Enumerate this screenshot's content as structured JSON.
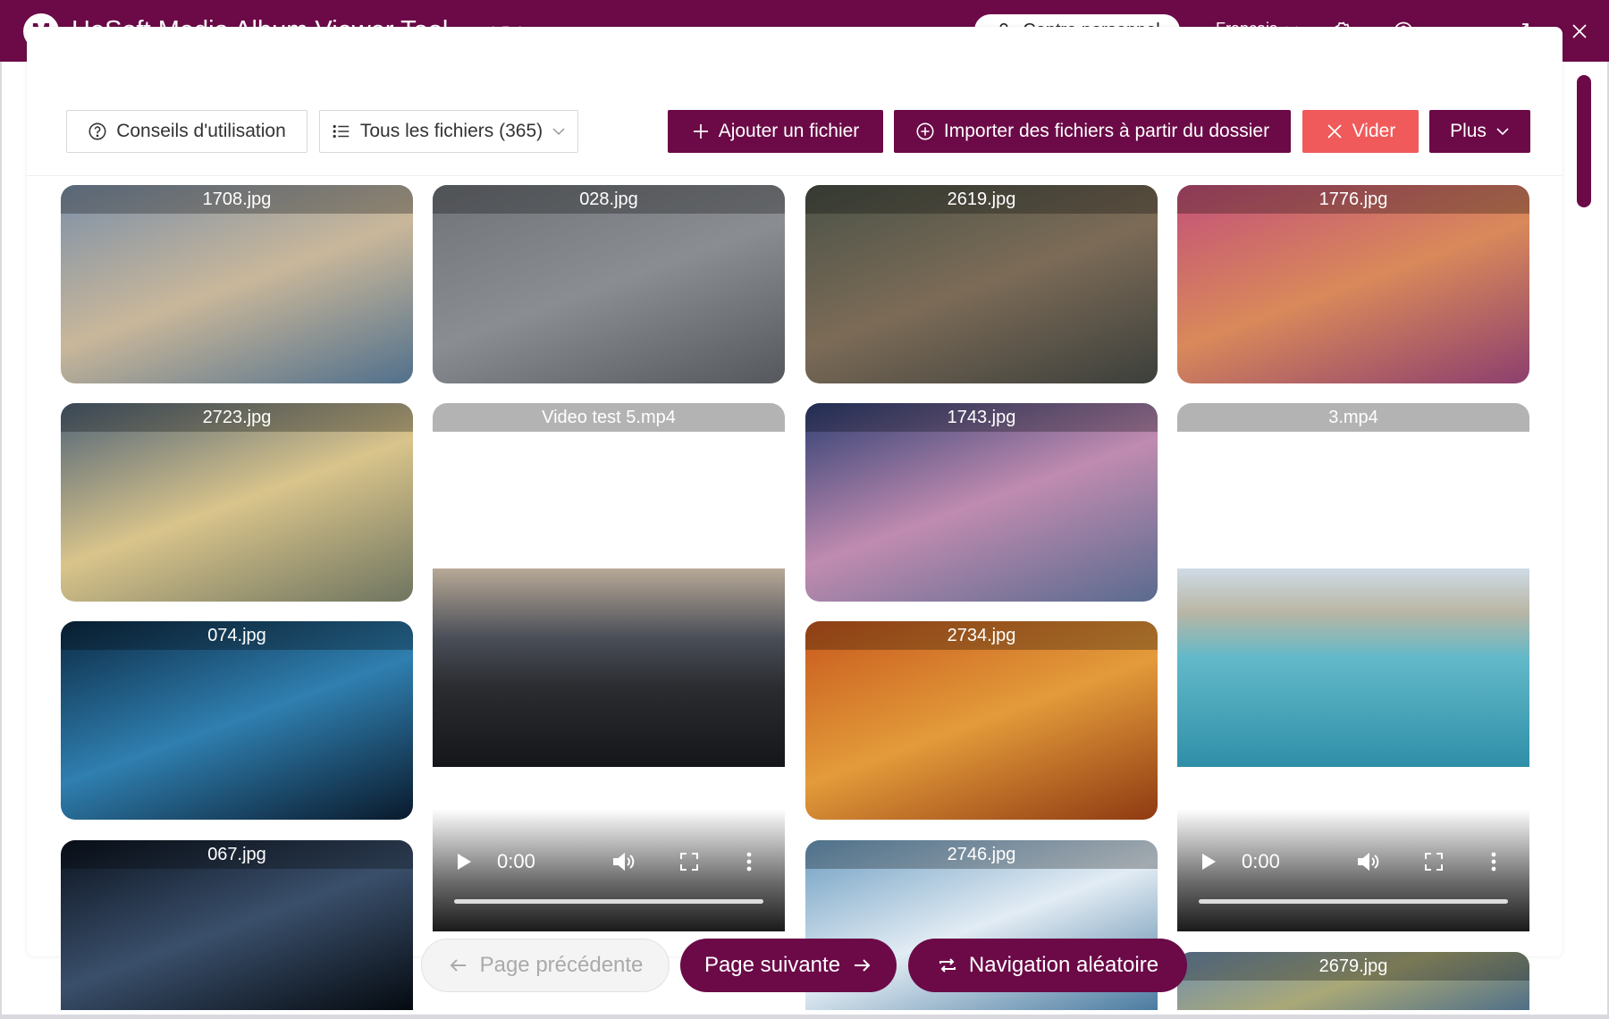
{
  "titlebar": {
    "logo_letter": "M",
    "title": "HeSoft Media Album Viewer Tool",
    "version": "- v1.5.4",
    "account_label": "Centre personnel",
    "language": "Français"
  },
  "toolbar": {
    "tips_label": "Conseils d'utilisation",
    "filter_label": "Tous les fichiers (365)",
    "add_file_label": "Ajouter un fichier",
    "import_folder_label": "Importer des fichiers à partir du dossier",
    "clear_label": "Vider",
    "more_label": "Plus"
  },
  "tiles": [
    {
      "name": "1708.jpg",
      "colors": [
        "#7b8fa8",
        "#c9b79a",
        "#51708c"
      ]
    },
    {
      "name": "028.jpg",
      "colors": [
        "#6f7378",
        "#8a8d92",
        "#55585c"
      ]
    },
    {
      "name": "2619.jpg",
      "colors": [
        "#4a5247",
        "#7c6b57",
        "#3c3f3b"
      ]
    },
    {
      "name": "1776.jpg",
      "colors": [
        "#c3507a",
        "#d9895a",
        "#8d3f6e"
      ]
    },
    {
      "name": "2723.jpg",
      "colors": [
        "#4f6377",
        "#d9c48b",
        "#6f7560"
      ]
    },
    {
      "name": "1743.jpg",
      "colors": [
        "#2e3f73",
        "#c08bb0",
        "#5a6b8f"
      ]
    },
    {
      "name": "074.jpg",
      "colors": [
        "#0c2a44",
        "#2f7fb0",
        "#0a1a2c"
      ]
    },
    {
      "name": "2734.jpg",
      "colors": [
        "#c7581d",
        "#e39b3a",
        "#8f3a12"
      ]
    },
    {
      "name": "067.jpg",
      "colors": [
        "#0c1420",
        "#3a4f6b",
        "#050a10"
      ]
    },
    {
      "name": "2746.jpg",
      "colors": [
        "#6d9dc1",
        "#e2ecf4",
        "#4b7ba0"
      ]
    },
    {
      "name": "2679.jpg",
      "colors": [
        "#6f8fb0",
        "#a9a877",
        "#4f6f88"
      ]
    }
  ],
  "videos": [
    {
      "name": "Video test 5.mp4",
      "time": "0:00"
    },
    {
      "name": "3.mp4",
      "time": "0:00"
    }
  ],
  "pager": {
    "prev_label": "Page précédente",
    "next_label": "Page suivante",
    "random_label": "Navigation aléatoire"
  }
}
